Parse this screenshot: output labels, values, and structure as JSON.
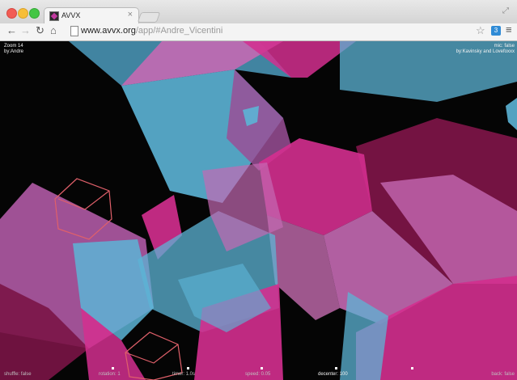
{
  "browser": {
    "tab_title": "AVVX",
    "tab_close": "×",
    "url_host": "www.avvx.org",
    "url_path": "/app/#Andre_Vicentini",
    "ext_label": "3",
    "icons": [
      "close-light",
      "minimize-light",
      "maximize-light",
      "back-icon",
      "forward-icon",
      "reload-icon",
      "home-icon",
      "page-icon",
      "star-icon",
      "menu-icon"
    ]
  },
  "hud": {
    "zoom": "Zoom 14",
    "by_left": "by:Andre",
    "mic": "mic: false",
    "by_right": "by:Kavinsky and Lovefoxxx",
    "shuffle": "shuffle: false",
    "rotation": "rotation: 1",
    "timer": "timer: 1.0s",
    "speed": "speed: 0.05",
    "decenter": "decenter: 100",
    "backflip": "back: false"
  },
  "colors": {
    "magenta": "#d42f8f",
    "pink": "#c469b3",
    "cyan": "#5cb4d6",
    "wine": "#7a1446",
    "background": "#050505"
  }
}
